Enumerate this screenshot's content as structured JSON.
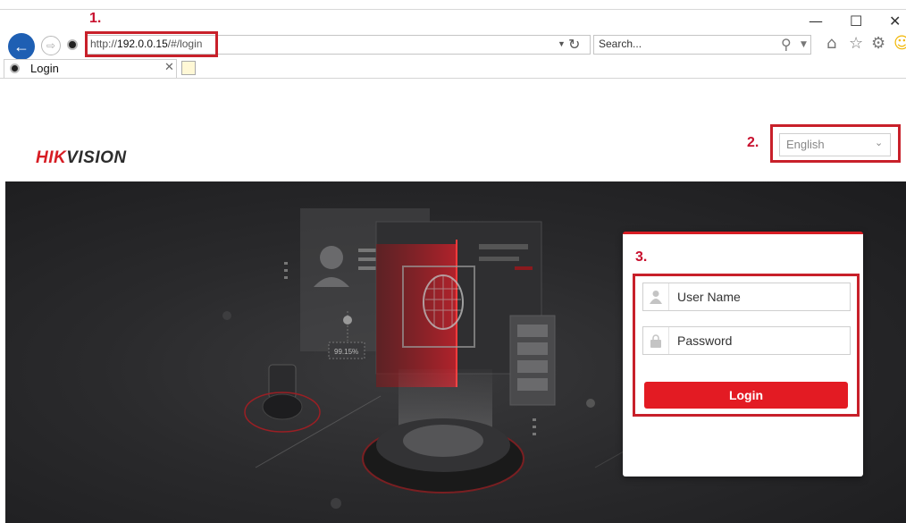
{
  "browser": {
    "address": {
      "scheme": "http://",
      "host": "192.0.0.15",
      "path": "/#/login"
    },
    "search_placeholder": "Search...",
    "tab_title": "Login",
    "window_controls": {
      "minimize": "—",
      "maximize": "☐",
      "close": "✕"
    }
  },
  "brand": {
    "logo_hik": "HIK",
    "logo_vision": "VISION"
  },
  "annotations": [
    "1.",
    "2.",
    "3."
  ],
  "language": {
    "selected": "English"
  },
  "hero": {
    "match_score": "99.15%"
  },
  "login": {
    "username_placeholder": "User Name",
    "password_placeholder": "Password",
    "button_label": "Login"
  },
  "colors": {
    "brand_red": "#d71d24",
    "annotation_red": "#c8202a",
    "nav_blue": "#1e5fb3"
  }
}
